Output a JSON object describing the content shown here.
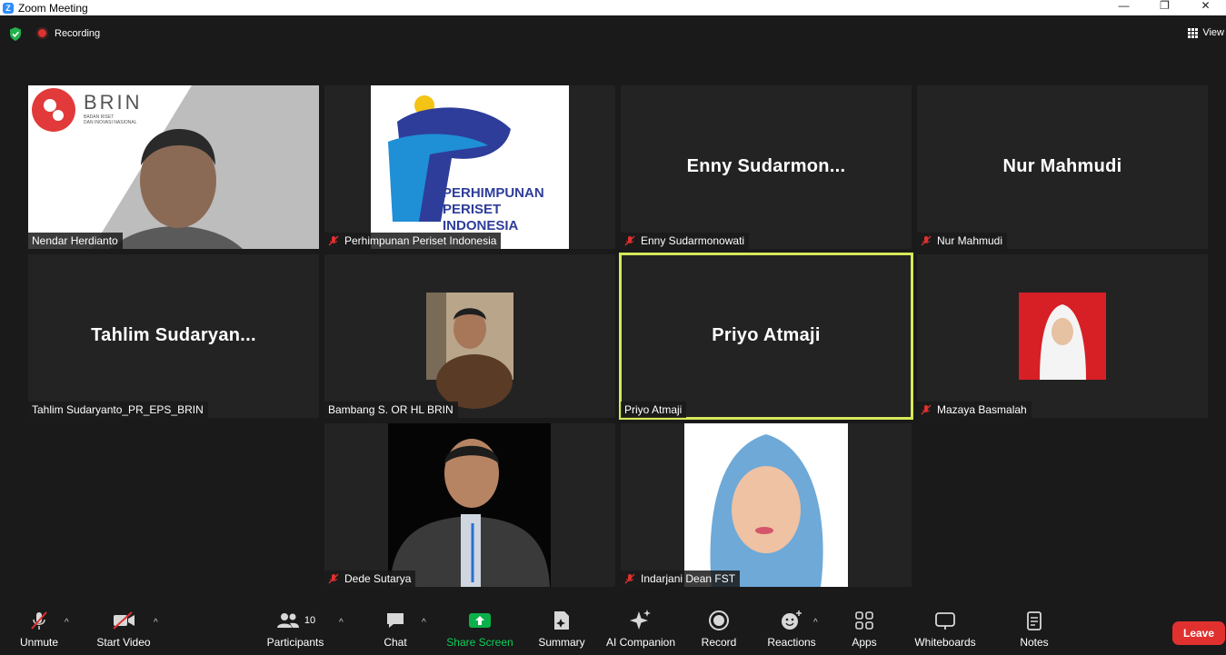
{
  "window": {
    "title": "Zoom Meeting"
  },
  "topbar": {
    "recording": "Recording",
    "view": "View"
  },
  "tiles": [
    {
      "name": "Nendar Herdianto",
      "muted": false
    },
    {
      "name": "Perhimpunan Periset Indonesia",
      "muted": true,
      "logo_text": [
        "PERHIMPUNAN",
        "PERISET",
        "INDONESIA"
      ]
    },
    {
      "name": "Enny Sudarmonowati",
      "muted": true,
      "display": "Enny  Sudarmon..."
    },
    {
      "name": "Nur Mahmudi",
      "muted": true,
      "display": "Nur Mahmudi"
    },
    {
      "name": "Tahlim Sudaryanto_PR_EPS_BRIN",
      "muted": false,
      "display": "Tahlim  Sudaryan..."
    },
    {
      "name": "Bambang S. OR HL BRIN",
      "muted": false
    },
    {
      "name": "Priyo Atmaji",
      "muted": false,
      "display": "Priyo Atmaji",
      "active_speaker": true
    },
    {
      "name": "Mazaya Basmalah",
      "muted": true
    },
    {
      "name": "Dede Sutarya",
      "muted": true
    },
    {
      "name": "Indarjani Dean FST",
      "muted": true
    }
  ],
  "brin": {
    "name": "BRIN",
    "sub1": "BADAN RISET",
    "sub2": "DAN INOVASI NASIONAL"
  },
  "toolbar": {
    "unmute": "Unmute",
    "start_video": "Start Video",
    "participants": "Participants",
    "participants_count": "10",
    "chat": "Chat",
    "share_screen": "Share Screen",
    "summary": "Summary",
    "ai_companion": "AI Companion",
    "record": "Record",
    "reactions": "Reactions",
    "apps": "Apps",
    "whiteboards": "Whiteboards",
    "notes": "Notes",
    "leave": "Leave"
  },
  "colors": {
    "accent_green": "#0bb04a",
    "leave_red": "#e0312f",
    "active_border": "#d7e85a",
    "mute_red": "#e0312f"
  }
}
